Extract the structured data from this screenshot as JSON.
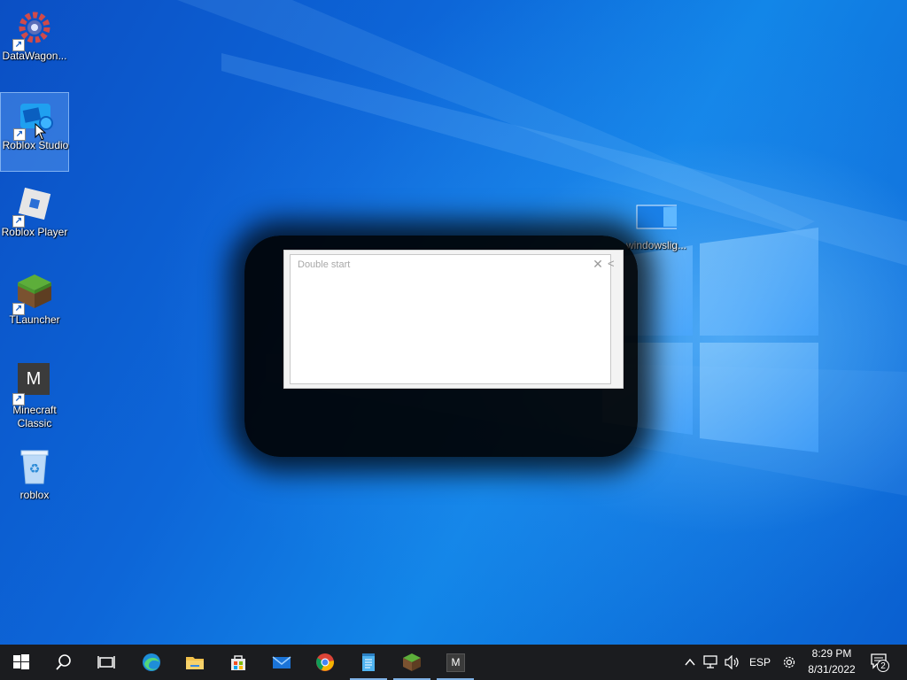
{
  "desktop_icons": [
    {
      "label": "DataWagon...",
      "icon": "datawagon-gear-icon"
    },
    {
      "label": "Roblox Studio",
      "icon": "roblox-studio-icon"
    },
    {
      "label": "Roblox Player",
      "icon": "roblox-player-icon"
    },
    {
      "label": "TLauncher",
      "icon": "tlauncher-grass-block-icon"
    },
    {
      "label": "Minecraft\nClassic",
      "icon": "minecraft-classic-m-icon"
    },
    {
      "label": "roblox",
      "icon": "recycle-bin-icon"
    },
    {
      "label": "windowslig...",
      "icon": "image-file-icon"
    }
  ],
  "dialog": {
    "title": "Double start",
    "close_glyph": "✕"
  },
  "taskbar": {
    "apps": [
      {
        "name": "start-button",
        "icon": "windows-start-icon"
      },
      {
        "name": "search-button",
        "icon": "search-icon"
      },
      {
        "name": "task-view-button",
        "icon": "task-view-icon"
      },
      {
        "name": "edge",
        "icon": "edge-icon"
      },
      {
        "name": "file-explorer",
        "icon": "folder-icon"
      },
      {
        "name": "microsoft-store",
        "icon": "store-icon"
      },
      {
        "name": "mail",
        "icon": "mail-icon"
      },
      {
        "name": "chrome",
        "icon": "chrome-icon"
      },
      {
        "name": "notepad",
        "icon": "notepad-icon"
      },
      {
        "name": "tlauncher",
        "icon": "grass-block-icon"
      },
      {
        "name": "minecraft-classic",
        "icon": "m-app-icon"
      }
    ],
    "tray": {
      "language": "ESP",
      "time": "8:29 PM",
      "date": "8/31/2022",
      "notification_count": "2"
    }
  },
  "colors": {
    "desktop_blue": "#0d66d8",
    "taskbar": "#1b1c1f",
    "running_indicator": "#7fb2e6"
  }
}
